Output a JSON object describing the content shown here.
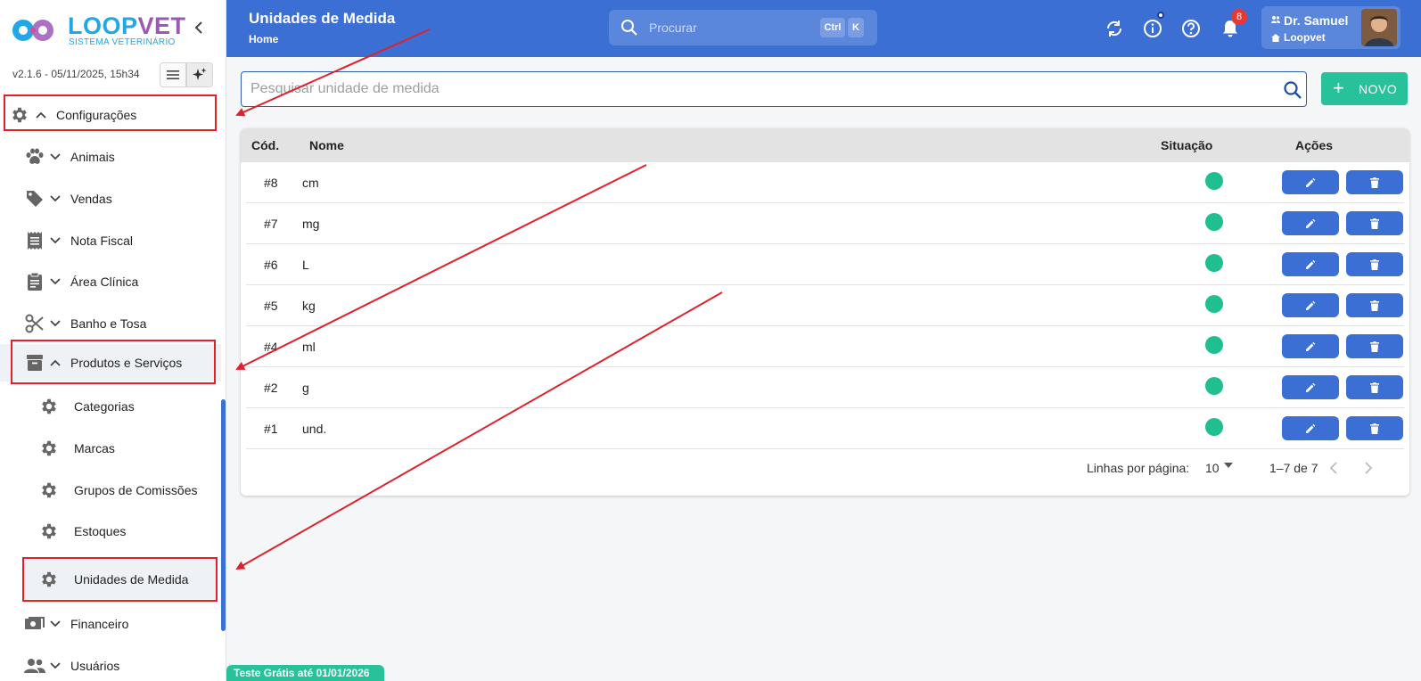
{
  "brand": {
    "name_part1": "LOOP",
    "name_part2": "VET",
    "subtitle": "SISTEMA VETERINÁRIO"
  },
  "version": "v2.1.6 - 05/11/2025, 15h34",
  "sidebar": {
    "items": [
      {
        "label": "Configurações",
        "icon": "gear-icon",
        "expanded": true
      },
      {
        "label": "Animais",
        "icon": "paw-icon"
      },
      {
        "label": "Vendas",
        "icon": "tag-icon"
      },
      {
        "label": "Nota Fiscal",
        "icon": "receipt-icon"
      },
      {
        "label": "Área Clínica",
        "icon": "clipboard-icon"
      },
      {
        "label": "Banho e Tosa",
        "icon": "scissors-icon"
      },
      {
        "label": "Produtos e Serviços",
        "icon": "archive-icon",
        "expanded": true
      },
      {
        "label": "Categorias",
        "icon": "gear-icon"
      },
      {
        "label": "Marcas",
        "icon": "gear-icon"
      },
      {
        "label": "Grupos de Comissões",
        "icon": "gear-icon"
      },
      {
        "label": "Estoques",
        "icon": "gear-icon"
      },
      {
        "label": "Unidades de Medida",
        "icon": "gear-icon",
        "active": true
      },
      {
        "label": "Financeiro",
        "icon": "money-icon"
      },
      {
        "label": "Usuários",
        "icon": "users-icon"
      }
    ]
  },
  "header": {
    "title": "Unidades de Medida",
    "breadcrumb": "Home",
    "search_placeholder": "Procurar",
    "shortcut_ctrl": "Ctrl",
    "shortcut_k": "K",
    "notifications_count": "8",
    "user_name": "Dr. Samuel",
    "user_org": "Loopvet"
  },
  "main": {
    "filter_placeholder": "Pesquisar unidade de medida",
    "new_button": "NOVO",
    "table": {
      "columns": [
        "Cód.",
        "Nome",
        "Situação",
        "Ações"
      ],
      "rows": [
        {
          "code": "#8",
          "name": "cm",
          "active": true
        },
        {
          "code": "#7",
          "name": "mg",
          "active": true
        },
        {
          "code": "#6",
          "name": "L",
          "active": true
        },
        {
          "code": "#5",
          "name": "kg",
          "active": true
        },
        {
          "code": "#4",
          "name": "ml",
          "active": true
        },
        {
          "code": "#2",
          "name": "g",
          "active": true
        },
        {
          "code": "#1",
          "name": "und.",
          "active": true
        }
      ]
    },
    "pagination": {
      "rows_per_page_label": "Linhas por página:",
      "rows_per_page": "10",
      "range": "1–7 de 7"
    }
  },
  "trial_badge": "Teste Grátis até 01/01/2026",
  "colors": {
    "primary": "#3b6fd4",
    "success": "#27c19a",
    "status_active": "#1fbf8f",
    "annotation": "#e0202a"
  }
}
